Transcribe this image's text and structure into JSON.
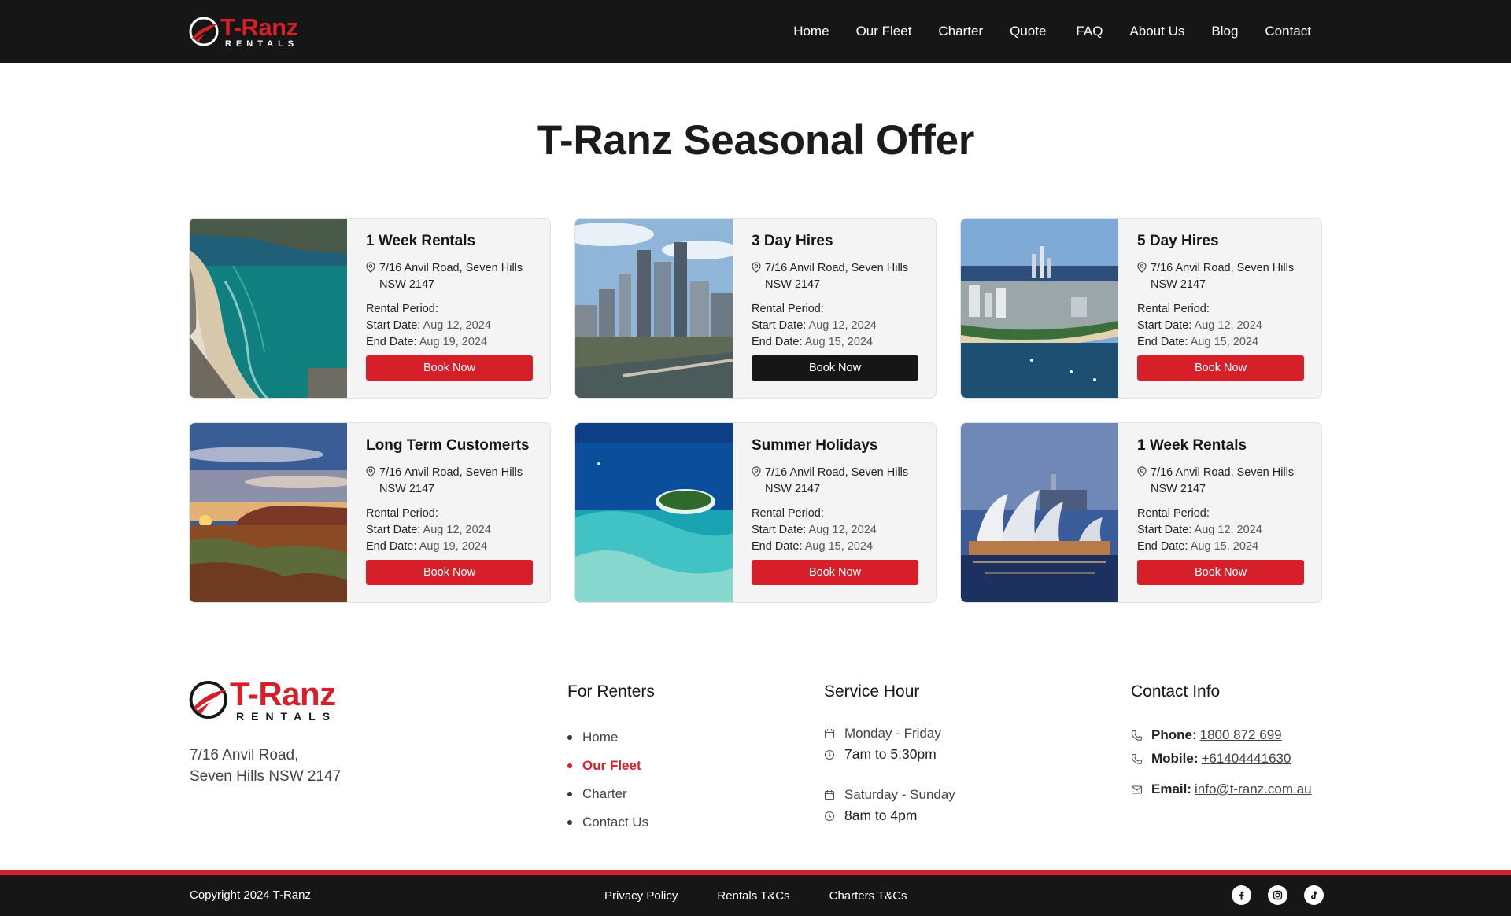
{
  "brand": {
    "name": "T-Ranz",
    "sub": "RENTALS",
    "accent": "#d71f29",
    "dark": "#161616"
  },
  "nav": [
    {
      "label": "Home"
    },
    {
      "label": "Our Fleet"
    },
    {
      "label": "Charter"
    },
    {
      "label": "Quote"
    },
    {
      "label": "FAQ"
    },
    {
      "label": "About Us"
    },
    {
      "label": "Blog"
    },
    {
      "label": "Contact"
    }
  ],
  "page_title": "T-Ranz Seasonal Offer",
  "cards": [
    {
      "title": "1 Week Rentals",
      "image": "bondi-beach-aerial",
      "address": "7/16 Anvil Road, Seven Hills NSW 2147",
      "period_label": "Rental Period:",
      "start_label": "Start Date:",
      "start": "Aug 12, 2024",
      "end_label": "End Date:",
      "end": "Aug 19, 2024",
      "button": "Book Now"
    },
    {
      "title": "3 Day Hires",
      "image": "melbourne-skyline",
      "address": "7/16 Anvil Road, Seven Hills NSW 2147",
      "period_label": "Rental Period:",
      "start_label": "Start Date:",
      "start": "Aug 12, 2024",
      "end_label": "End Date:",
      "end": "Aug 15, 2024",
      "button": "Book Now"
    },
    {
      "title": "5 Day Hires",
      "image": "gold-coast-harbour",
      "address": "7/16 Anvil Road, Seven Hills NSW 2147",
      "period_label": "Rental Period:",
      "start_label": "Start Date:",
      "start": "Aug 12, 2024",
      "end_label": "End Date:",
      "end": "Aug 15, 2024",
      "button": "Book Now"
    },
    {
      "title": "Long Term Customerts",
      "image": "uluru-sunset",
      "address": "7/16 Anvil Road, Seven Hills NSW 2147",
      "period_label": "Rental Period:",
      "start_label": "Start Date:",
      "start": "Aug 12, 2024",
      "end_label": "End Date:",
      "end": "Aug 19, 2024",
      "button": "Book Now"
    },
    {
      "title": "Summer Holidays",
      "image": "reef-island",
      "address": "7/16 Anvil Road, Seven Hills NSW 2147",
      "period_label": "Rental Period:",
      "start_label": "Start Date:",
      "start": "Aug 12, 2024",
      "end_label": "End Date:",
      "end": "Aug 15, 2024",
      "button": "Book Now"
    },
    {
      "title": "1 Week Rentals",
      "image": "sydney-opera-house",
      "address": "7/16 Anvil Road, Seven Hills NSW 2147",
      "period_label": "Rental Period:",
      "start_label": "Start Date:",
      "start": "Aug 12, 2024",
      "end_label": "End Date:",
      "end": "Aug 15, 2024",
      "button": "Book Now"
    }
  ],
  "footer": {
    "address_line1": "7/16 Anvil Road,",
    "address_line2": "Seven Hills NSW 2147",
    "renters_title": "For Renters",
    "renters_links": [
      {
        "label": "Home"
      },
      {
        "label": "Our Fleet"
      },
      {
        "label": "Charter"
      },
      {
        "label": "Contact Us"
      }
    ],
    "service_title": "Service Hour",
    "weekday_days": "Monday - Friday",
    "weekday_hours": "7am to 5:30pm",
    "weekend_days": "Saturday - Sunday",
    "weekend_hours": "8am to 4pm",
    "contact_title": "Contact Info",
    "phone_label": "Phone:",
    "phone": "1800 872 699",
    "mobile_label": "Mobile:",
    "mobile": "+61404441630",
    "email_label": "Email:",
    "email": "info@t-ranz.com.au"
  },
  "bottom": {
    "copyright": "Copyright 2024 T-Ranz",
    "links": [
      {
        "label": "Privacy Policy"
      },
      {
        "label": "Rentals T&Cs"
      },
      {
        "label": "Charters T&Cs"
      }
    ],
    "social": [
      "facebook-icon",
      "instagram-icon",
      "tiktok-icon"
    ]
  }
}
